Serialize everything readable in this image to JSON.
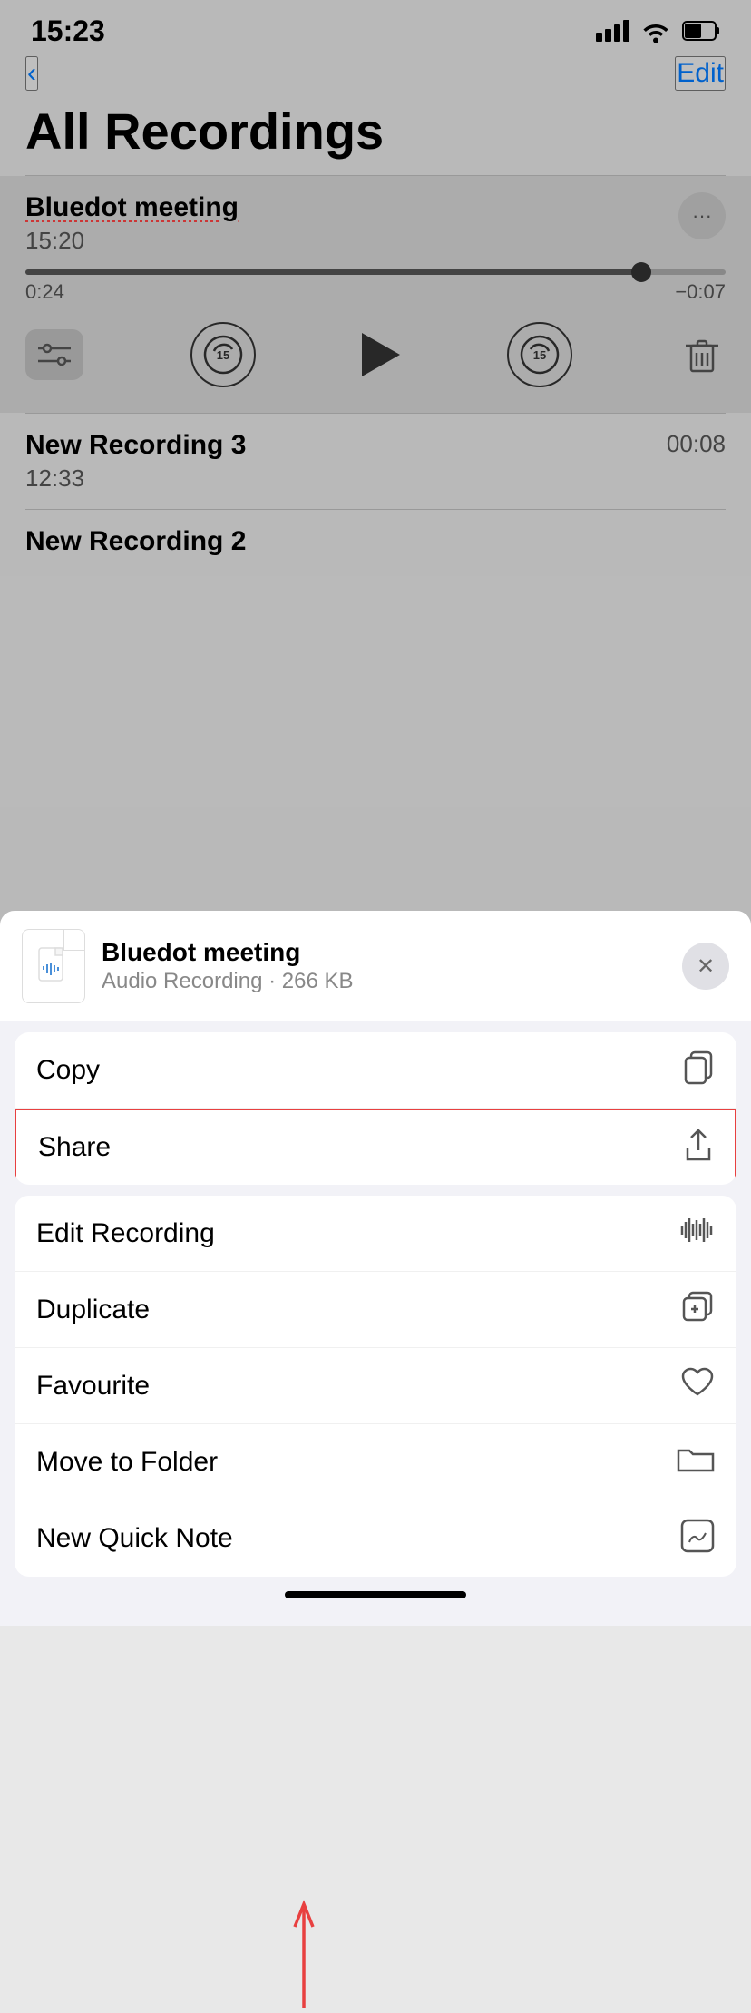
{
  "statusBar": {
    "time": "15:23"
  },
  "navBar": {
    "back": "‹",
    "edit": "Edit"
  },
  "pageTitle": "All Recordings",
  "activeRecording": {
    "title": "Bluedot meeting",
    "time": "15:20",
    "progressCurrent": "0:24",
    "progressRemaining": "−0:07"
  },
  "recordings": [
    {
      "title": "New Recording 3",
      "time": "12:33",
      "duration": "00:08"
    },
    {
      "title": "New Recording 2",
      "time": "",
      "duration": ""
    }
  ],
  "bottomSheet": {
    "fileName": "Bluedot meeting",
    "fileMeta": "Audio Recording · 266 KB"
  },
  "menuItems": [
    {
      "label": "Copy",
      "icon": "copy"
    },
    {
      "label": "Share",
      "icon": "share",
      "highlighted": true
    },
    {
      "label": "Edit Recording",
      "icon": "waveform"
    },
    {
      "label": "Duplicate",
      "icon": "duplicate"
    },
    {
      "label": "Favourite",
      "icon": "heart"
    },
    {
      "label": "Move to Folder",
      "icon": "folder"
    },
    {
      "label": "New Quick Note",
      "icon": "note"
    }
  ]
}
